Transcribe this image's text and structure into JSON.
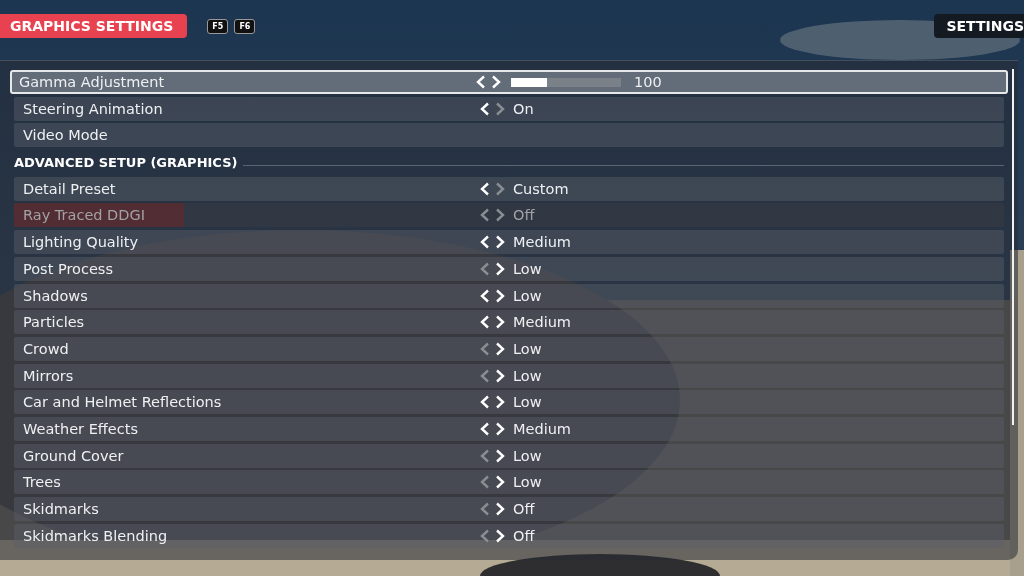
{
  "header": {
    "title": "GRAPHICS SETTINGS",
    "keys": [
      "F5",
      "F6"
    ],
    "right_tab": "SETTINGS"
  },
  "rows": [
    {
      "kind": "slider",
      "label": "Gamma Adjustment",
      "selected": true,
      "disabled": false,
      "prev_enabled": true,
      "next_enabled": true,
      "level": 0.33,
      "value": "100"
    },
    {
      "kind": "option",
      "label": "Steering Animation",
      "selected": false,
      "disabled": false,
      "prev_enabled": true,
      "next_enabled": false,
      "value": "On"
    },
    {
      "kind": "link",
      "label": "Video Mode",
      "selected": false,
      "disabled": false
    },
    {
      "kind": "section",
      "label": "ADVANCED SETUP (GRAPHICS)"
    },
    {
      "kind": "option",
      "label": "Detail Preset",
      "selected": false,
      "disabled": false,
      "prev_enabled": true,
      "next_enabled": false,
      "value": "Custom"
    },
    {
      "kind": "option",
      "label": "Ray Traced DDGI",
      "selected": false,
      "disabled": true,
      "prev_enabled": false,
      "next_enabled": false,
      "value": "Off"
    },
    {
      "kind": "option",
      "label": "Lighting Quality",
      "selected": false,
      "disabled": false,
      "prev_enabled": true,
      "next_enabled": true,
      "value": "Medium"
    },
    {
      "kind": "option",
      "label": "Post Process",
      "selected": false,
      "disabled": false,
      "prev_enabled": false,
      "next_enabled": true,
      "value": "Low"
    },
    {
      "kind": "option",
      "label": "Shadows",
      "selected": false,
      "disabled": false,
      "prev_enabled": true,
      "next_enabled": true,
      "value": "Low"
    },
    {
      "kind": "option",
      "label": "Particles",
      "selected": false,
      "disabled": false,
      "prev_enabled": true,
      "next_enabled": true,
      "value": "Medium"
    },
    {
      "kind": "option",
      "label": "Crowd",
      "selected": false,
      "disabled": false,
      "prev_enabled": false,
      "next_enabled": true,
      "value": "Low"
    },
    {
      "kind": "option",
      "label": "Mirrors",
      "selected": false,
      "disabled": false,
      "prev_enabled": false,
      "next_enabled": true,
      "value": "Low"
    },
    {
      "kind": "option",
      "label": "Car and Helmet Reflections",
      "selected": false,
      "disabled": false,
      "prev_enabled": true,
      "next_enabled": true,
      "value": "Low"
    },
    {
      "kind": "option",
      "label": "Weather Effects",
      "selected": false,
      "disabled": false,
      "prev_enabled": true,
      "next_enabled": true,
      "value": "Medium"
    },
    {
      "kind": "option",
      "label": "Ground Cover",
      "selected": false,
      "disabled": false,
      "prev_enabled": false,
      "next_enabled": true,
      "value": "Low"
    },
    {
      "kind": "option",
      "label": "Trees",
      "selected": false,
      "disabled": false,
      "prev_enabled": false,
      "next_enabled": true,
      "value": "Low"
    },
    {
      "kind": "option",
      "label": "Skidmarks",
      "selected": false,
      "disabled": false,
      "prev_enabled": false,
      "next_enabled": true,
      "value": "Off"
    },
    {
      "kind": "option",
      "label": "Skidmarks Blending",
      "selected": false,
      "disabled": false,
      "prev_enabled": false,
      "next_enabled": true,
      "value": "Off"
    }
  ]
}
